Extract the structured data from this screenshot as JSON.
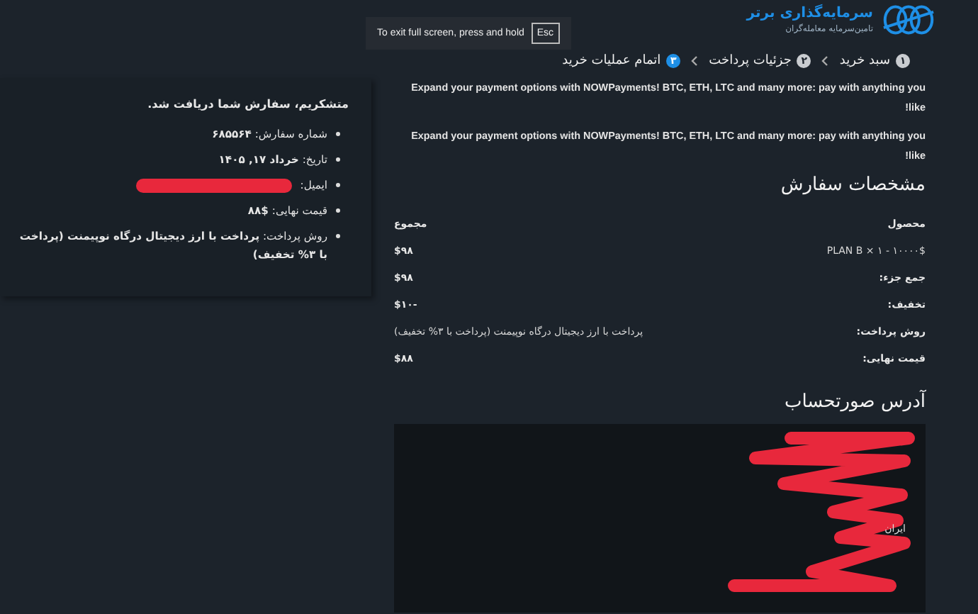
{
  "logo": {
    "name": "سرمایه‌گذاری برتر",
    "tagline": "تامین‌سرمایه معامله‌گران"
  },
  "fullscreen_notice": {
    "text": "To exit full screen, press and hold",
    "key": "Esc"
  },
  "steps": [
    {
      "number": "۱",
      "label": "سبد خرید",
      "selected": false
    },
    {
      "number": "۲",
      "label": "جزئیات پرداخت",
      "selected": false
    },
    {
      "number": "۳",
      "label": "اتمام عملیات خرید",
      "selected": true
    }
  ],
  "promos": [
    "Expand your payment options with NOWPayments! BTC, ETH, LTC and many more: pay with anything you like!",
    "Expand your payment options with NOWPayments! BTC, ETH, LTC and many more: pay with anything you like!"
  ],
  "order_heading": "مشخصات سفارش",
  "order_table": {
    "columns": [
      "محصول",
      "مجموع"
    ],
    "rows": [
      {
        "label": "PLAN B × ۱ - ۱۰۰۰۰$",
        "value": "$۹۸",
        "kind": "item"
      },
      {
        "label": "جمع جزء:",
        "value": "$۹۸",
        "kind": "total"
      },
      {
        "label": "تخفیف:",
        "value": "$۱۰-",
        "kind": "total"
      },
      {
        "label": "روش پرداخت:",
        "value": "پرداخت با ارز دیجیتال درگاه نوپیمنت (پرداخت با ۳% تخفیف)",
        "kind": "total"
      },
      {
        "label": "قیمت نهایی:",
        "value": "$۸۸",
        "kind": "total"
      }
    ]
  },
  "billing_heading": "آدرس صورتحساب",
  "billing_address": {
    "lines": [
      "ایران"
    ],
    "redacted": true
  },
  "confirmation": {
    "title": "متشکریم، سفارش شما دریافت شد.",
    "items": [
      {
        "text": "شماره سفارش: **۶۸۵۵۶۴**",
        "redacted": false
      },
      {
        "text": "تاریخ: **خرداد ۱۷, ۱۴۰۵**",
        "redacted": false
      },
      {
        "text": "ایمیل:",
        "redacted": true
      },
      {
        "text": "قیمت نهایی: **$۸۸**",
        "redacted": false
      },
      {
        "text": "روش پرداخت: **پرداخت با ارز دیجیتال درگاه نوپیمنت (پرداخت با ۳% تخفیف)**",
        "redacted": false
      }
    ]
  }
}
